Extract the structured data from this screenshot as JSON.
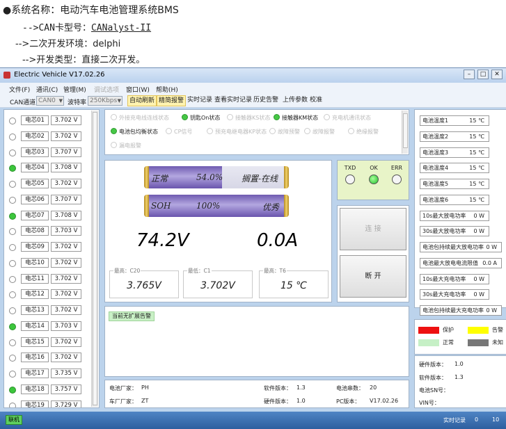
{
  "doc": {
    "line1": "●系统名称：电动汽车电池管理系统BMS",
    "line2_prefix": "-->CAN卡型号：",
    "line2_link": "CANalyst-II",
    "line3": "-->二次开发环境：delphi",
    "line4": "-->开发类型：直接二次开发。"
  },
  "window": {
    "title": "Electric Vehicle V17.02.26",
    "min": "–",
    "max": "□",
    "close": "✕"
  },
  "menu": [
    "文件(F)",
    "通讯(C)",
    "管理(M)",
    "调试选项",
    "窗口(W)",
    "帮助(H)"
  ],
  "toolbar": {
    "can_label": "CAN通道",
    "can_value": "CAN0",
    "baud_label": "波特率",
    "baud_value": "250Kbps",
    "btn_auto_refresh": "自动刷新",
    "btn_precise_alarm": "精简报警",
    "btn_realtime": "实时记录",
    "btn_view_realtime": "查看实时记录",
    "btn_history_alarm": "历史告警",
    "btn_upload_params": "上传参数",
    "btn_calibrate": "校准"
  },
  "cells": [
    {
      "name": "电芯01",
      "voltage": "3.702 V",
      "on": false
    },
    {
      "name": "电芯02",
      "voltage": "3.702 V",
      "on": false
    },
    {
      "name": "电芯03",
      "voltage": "3.707 V",
      "on": false
    },
    {
      "name": "电芯04",
      "voltage": "3.708 V",
      "on": true
    },
    {
      "name": "电芯05",
      "voltage": "3.702 V",
      "on": false
    },
    {
      "name": "电芯06",
      "voltage": "3.707 V",
      "on": false
    },
    {
      "name": "电芯07",
      "voltage": "3.708 V",
      "on": true
    },
    {
      "name": "电芯08",
      "voltage": "3.703 V",
      "on": false
    },
    {
      "name": "电芯09",
      "voltage": "3.702 V",
      "on": false
    },
    {
      "name": "电芯10",
      "voltage": "3.702 V",
      "on": false
    },
    {
      "name": "电芯11",
      "voltage": "3.702 V",
      "on": false
    },
    {
      "name": "电芯12",
      "voltage": "3.702 V",
      "on": false
    },
    {
      "name": "电芯13",
      "voltage": "3.702 V",
      "on": false
    },
    {
      "name": "电芯14",
      "voltage": "3.703 V",
      "on": true
    },
    {
      "name": "电芯15",
      "voltage": "3.702 V",
      "on": false
    },
    {
      "name": "电芯16",
      "voltage": "3.702 V",
      "on": false
    },
    {
      "name": "电芯17",
      "voltage": "3.735 V",
      "on": false
    },
    {
      "name": "电芯18",
      "voltage": "3.757 V",
      "on": true
    },
    {
      "name": "电芯19",
      "voltage": "3.729 V",
      "on": false
    }
  ],
  "status_items": [
    {
      "label": "外接充电线连线状态",
      "on": false,
      "active": false
    },
    {
      "label": "钥匙On状态",
      "on": true,
      "active": true
    },
    {
      "label": "接触器KS状态",
      "on": false,
      "active": false
    },
    {
      "label": "接触器KM状态",
      "on": true,
      "active": true
    },
    {
      "label": "充电机通讯状态",
      "on": false,
      "active": false
    },
    {
      "label": "电池包均衡状态",
      "on": true,
      "active": true
    },
    {
      "label": "CP信号",
      "on": false,
      "active": false
    },
    {
      "label": "预充电继电器KP状态",
      "on": false,
      "active": false
    },
    {
      "label": "故障预警",
      "on": false,
      "active": false
    },
    {
      "label": "故障报警",
      "on": false,
      "active": false
    },
    {
      "label": "绝缘报警",
      "on": false,
      "active": false
    },
    {
      "label": "漏电报警",
      "on": false,
      "active": false
    }
  ],
  "battery": {
    "state": "正常",
    "soc": "54.0%",
    "soc_fraction": 0.54,
    "mode": "搁置-在线",
    "soh_label": "SOH",
    "soh": "100%",
    "soh_fraction": 1.0,
    "soh_grade": "优秀",
    "voltage": "74.2V",
    "current": "0.0A"
  },
  "gauges": [
    {
      "label": "最高：C20",
      "value": "3.765V"
    },
    {
      "label": "最低：C1",
      "value": "3.702V"
    },
    {
      "label": "最高：T6",
      "value": "15 ℃"
    }
  ],
  "leds": [
    {
      "label": "TXD",
      "on": false
    },
    {
      "label": "OK",
      "on": true
    },
    {
      "label": "ERR",
      "on": false
    }
  ],
  "buttons": {
    "connect": "连 接",
    "disconnect": "断 开"
  },
  "alarm": {
    "message": "当前无扩展告警"
  },
  "info": {
    "manufacturer_label": "电池厂家：",
    "manufacturer": "PH",
    "sw_label": "软件版本：",
    "sw": "1.3",
    "series_label": "电池串数：",
    "series": "20",
    "car_label": "车厂厂家：",
    "car": "ZT",
    "hw_label": "硬件版本：",
    "hw": "1.0",
    "pc_label": "PC版本：",
    "pc": "V17.02.26"
  },
  "right_params": [
    {
      "label": "电池温度1",
      "value": "15 ℃"
    },
    {
      "label": "电池温度2",
      "value": "15 ℃"
    },
    {
      "label": "电池温度3",
      "value": "15 ℃"
    },
    {
      "label": "电池温度4",
      "value": "15 ℃"
    },
    {
      "label": "电池温度5",
      "value": "15 ℃"
    },
    {
      "label": "电池温度6",
      "value": "15 ℃"
    },
    {
      "label": "10s最大放电功率",
      "value": "0 W"
    },
    {
      "label": "30s最大放电功率",
      "value": "0 W"
    },
    {
      "label": "电池包持续最大放电功率",
      "value": "0 W"
    },
    {
      "label": "电池最大放电电流限值",
      "value": "0.0 A"
    },
    {
      "label": "10s最大充电功率",
      "value": "0 W"
    },
    {
      "label": "30s最大充电功率",
      "value": "0 W"
    },
    {
      "label": "电池包持续最大充电功率",
      "value": "0 W"
    }
  ],
  "legend": [
    {
      "label": "保护",
      "color": "#ee1111"
    },
    {
      "label": "告警",
      "color": "#ffff00"
    },
    {
      "label": "正常",
      "color": "#c6f0c6"
    },
    {
      "label": "未知",
      "color": "#777777"
    }
  ],
  "versions": {
    "hw_label": "硬件版本：",
    "hw": "1.0",
    "sw_label": "软件版本：",
    "sw": "1.3",
    "sn_label": "电池SN号：",
    "vin_label": "VIN号："
  },
  "statusbar": {
    "connected": "联机",
    "realtime": "实时记录",
    "count": "0",
    "count2": "10"
  }
}
